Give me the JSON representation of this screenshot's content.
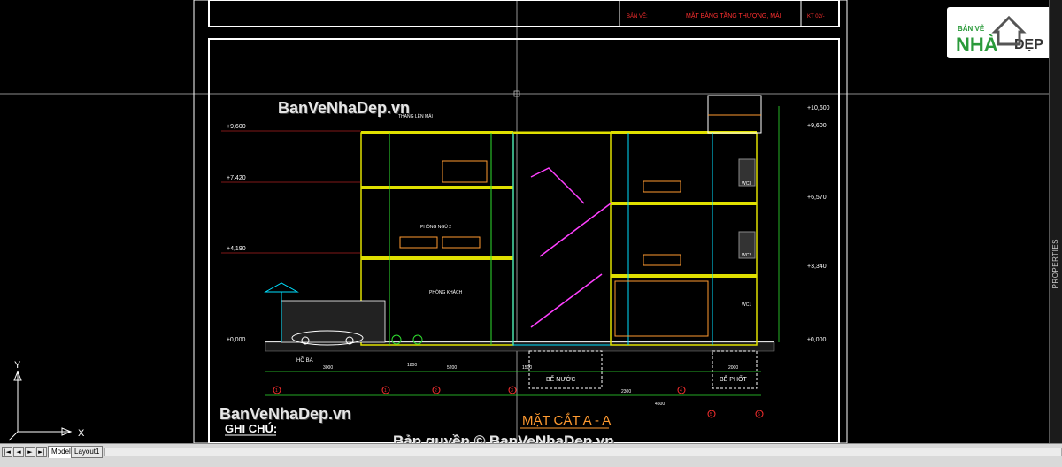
{
  "titleblock": {
    "label_drawing": "BẢN VẼ:",
    "drawing_name": "MẶT BẰNG TẦNG THƯỢNG, MÁI",
    "sheet_code": "KT 02/-"
  },
  "section_title": "MẶT CẮT A - A",
  "notes_heading": "GHI CHÚ:",
  "watermark_1": "BanVeNhaDep.vn",
  "watermark_2": "BanVeNhaDep.vn",
  "copyright": "Bản quyền © BanVeNhaDep.vn",
  "logo": {
    "line1": "BẢN VẼ",
    "line2": "NHÀ",
    "line3": "ĐẸP"
  },
  "levels_left": [
    "+9,600",
    "+7,420",
    "+4,190",
    "±0,000"
  ],
  "levels_right": [
    "+10,600",
    "+9,600",
    "+6,570",
    "+3,340",
    "±0,000"
  ],
  "room_labels": {
    "bedroom": "PHÒNG NGỦ 2",
    "living": "PHÒNG KHÁCH",
    "stair_roof": "THANG LÊN MÁI",
    "wc1": "WC1",
    "wc2": "WC2",
    "wc3": "WC3",
    "water_tank": "BỂ NƯỚC",
    "septic": "BỂ PHỐT",
    "parking": "HỒ BA"
  },
  "dims_bottom": [
    "3000",
    "1800",
    "5200",
    "1500",
    "2300",
    "4500",
    "2000"
  ],
  "grid_bubbles": [
    "1",
    "1",
    "2",
    "3",
    "4",
    "5",
    "6"
  ],
  "ucs": {
    "x": "X",
    "y": "Y"
  },
  "status": {
    "tabs": [
      "Model",
      "Layout1"
    ],
    "active_tab": "Model",
    "nav": [
      "|◄",
      "◄",
      "►",
      "►|"
    ]
  },
  "properties_label": "PROPERTIES",
  "colors": {
    "background": "#000000",
    "wall": "#e0e000",
    "cyan": "#00e0ff",
    "magenta": "#ff40ff",
    "red": "#ff3030",
    "green": "#30e030",
    "white": "#ffffff",
    "orange": "#ff9a30"
  }
}
